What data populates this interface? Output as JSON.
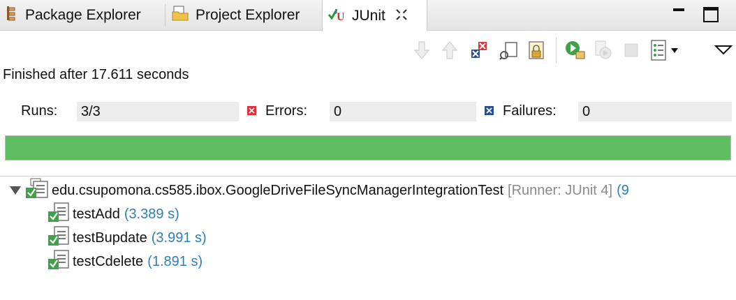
{
  "tabs": [
    {
      "label": "Package Explorer",
      "icon": "package-explorer-icon"
    },
    {
      "label": "Project Explorer",
      "icon": "project-explorer-icon"
    },
    {
      "label": "JUnit",
      "icon": "junit-icon",
      "active": true
    }
  ],
  "window_controls": [
    "minimize-icon",
    "maximize-icon"
  ],
  "toolbar_icons": [
    "next-failure-icon",
    "previous-failure-icon",
    "show-failures-only-icon",
    "scroll-lock-icon",
    "history-lock-icon",
    "rerun-test-icon",
    "rerun-failed-first-icon",
    "stop-icon",
    "test-run-history-icon",
    "view-menu-icon"
  ],
  "status": {
    "finished": "Finished after 17.611 seconds"
  },
  "counters": {
    "runs_label": "Runs:",
    "runs_value": "3/3",
    "errors_label": "Errors:",
    "errors_value": "0",
    "failures_label": "Failures:",
    "failures_value": "0"
  },
  "progress": {
    "fraction": 1.0,
    "color": "#5fbd61"
  },
  "tree": {
    "suite": {
      "name": "edu.csupomona.cs585.ibox.GoogleDriveFileSyncManagerIntegrationTest",
      "runner": "[Runner: JUnit 4]",
      "extra": "(9"
    },
    "tests": [
      {
        "name": "testAdd",
        "time": "(3.389 s)"
      },
      {
        "name": "testBupdate",
        "time": "(3.991 s)"
      },
      {
        "name": "testCdelete",
        "time": "(1.891 s)"
      }
    ]
  },
  "colors": {
    "accent_blue": "#2c7fb8",
    "runner_gray": "#8a8a8a",
    "pass_green": "#5fbd61",
    "error_red": "#d9343b",
    "failure_blue": "#2a4f8a"
  }
}
